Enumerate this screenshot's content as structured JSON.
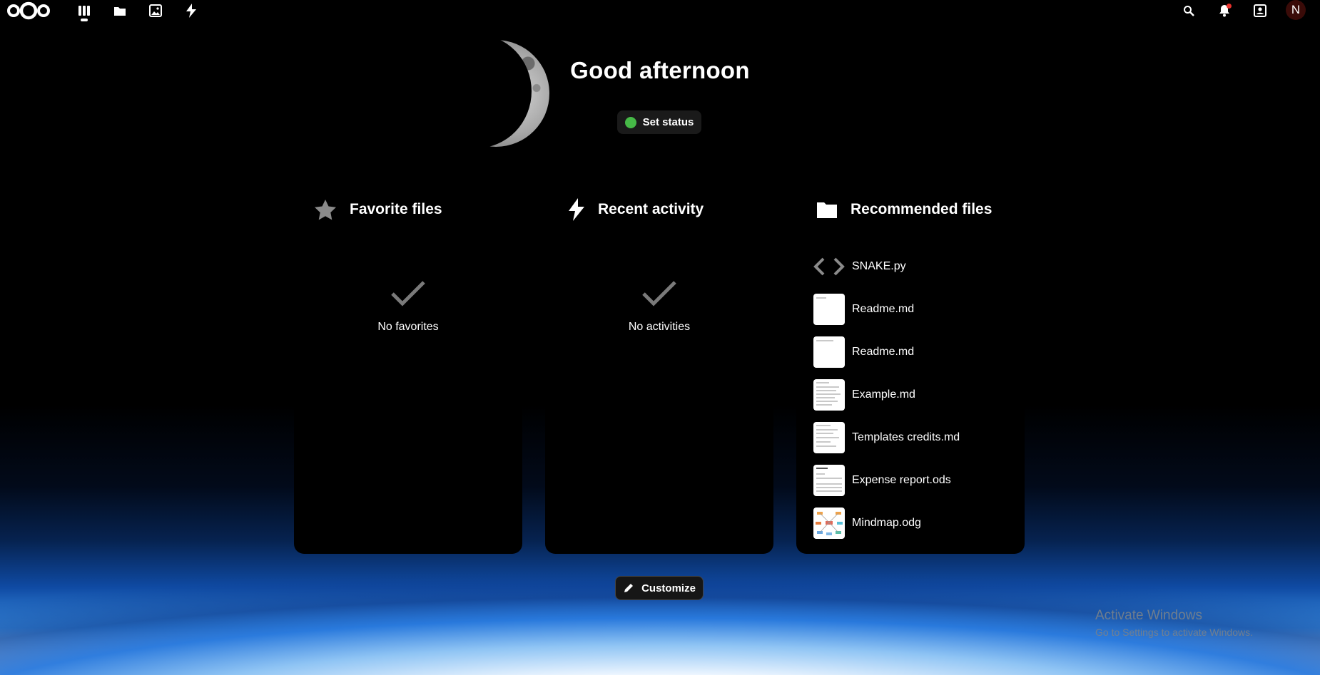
{
  "topbar": {
    "apps": [
      {
        "name": "dashboard",
        "icon": "dashboard-icon"
      },
      {
        "name": "files",
        "icon": "folder-icon"
      },
      {
        "name": "photos",
        "icon": "image-icon"
      },
      {
        "name": "activity",
        "icon": "lightning-icon"
      }
    ],
    "right": [
      "search-icon",
      "bell-icon",
      "contacts-icon"
    ],
    "avatar_initial": "N"
  },
  "greeting": "Good afternoon",
  "status": {
    "label": "Set status",
    "color": "#46b947"
  },
  "widgets": {
    "favorites": {
      "title": "Favorite files",
      "empty": "No favorites"
    },
    "activity": {
      "title": "Recent activity",
      "empty": "No activities"
    },
    "recommended": {
      "title": "Recommended files",
      "files": [
        {
          "name": "SNAKE.py",
          "thumb": "code"
        },
        {
          "name": "Readme.md",
          "thumb": "doc"
        },
        {
          "name": "Readme.md",
          "thumb": "doc"
        },
        {
          "name": "Example.md",
          "thumb": "doc"
        },
        {
          "name": "Templates credits.md",
          "thumb": "doc"
        },
        {
          "name": "Expense report.ods",
          "thumb": "sheet"
        },
        {
          "name": "Mindmap.odg",
          "thumb": "mindmap"
        }
      ]
    }
  },
  "customize_label": "Customize",
  "watermark": {
    "title": "Activate Windows",
    "subtitle": "Go to Settings to activate Windows."
  }
}
